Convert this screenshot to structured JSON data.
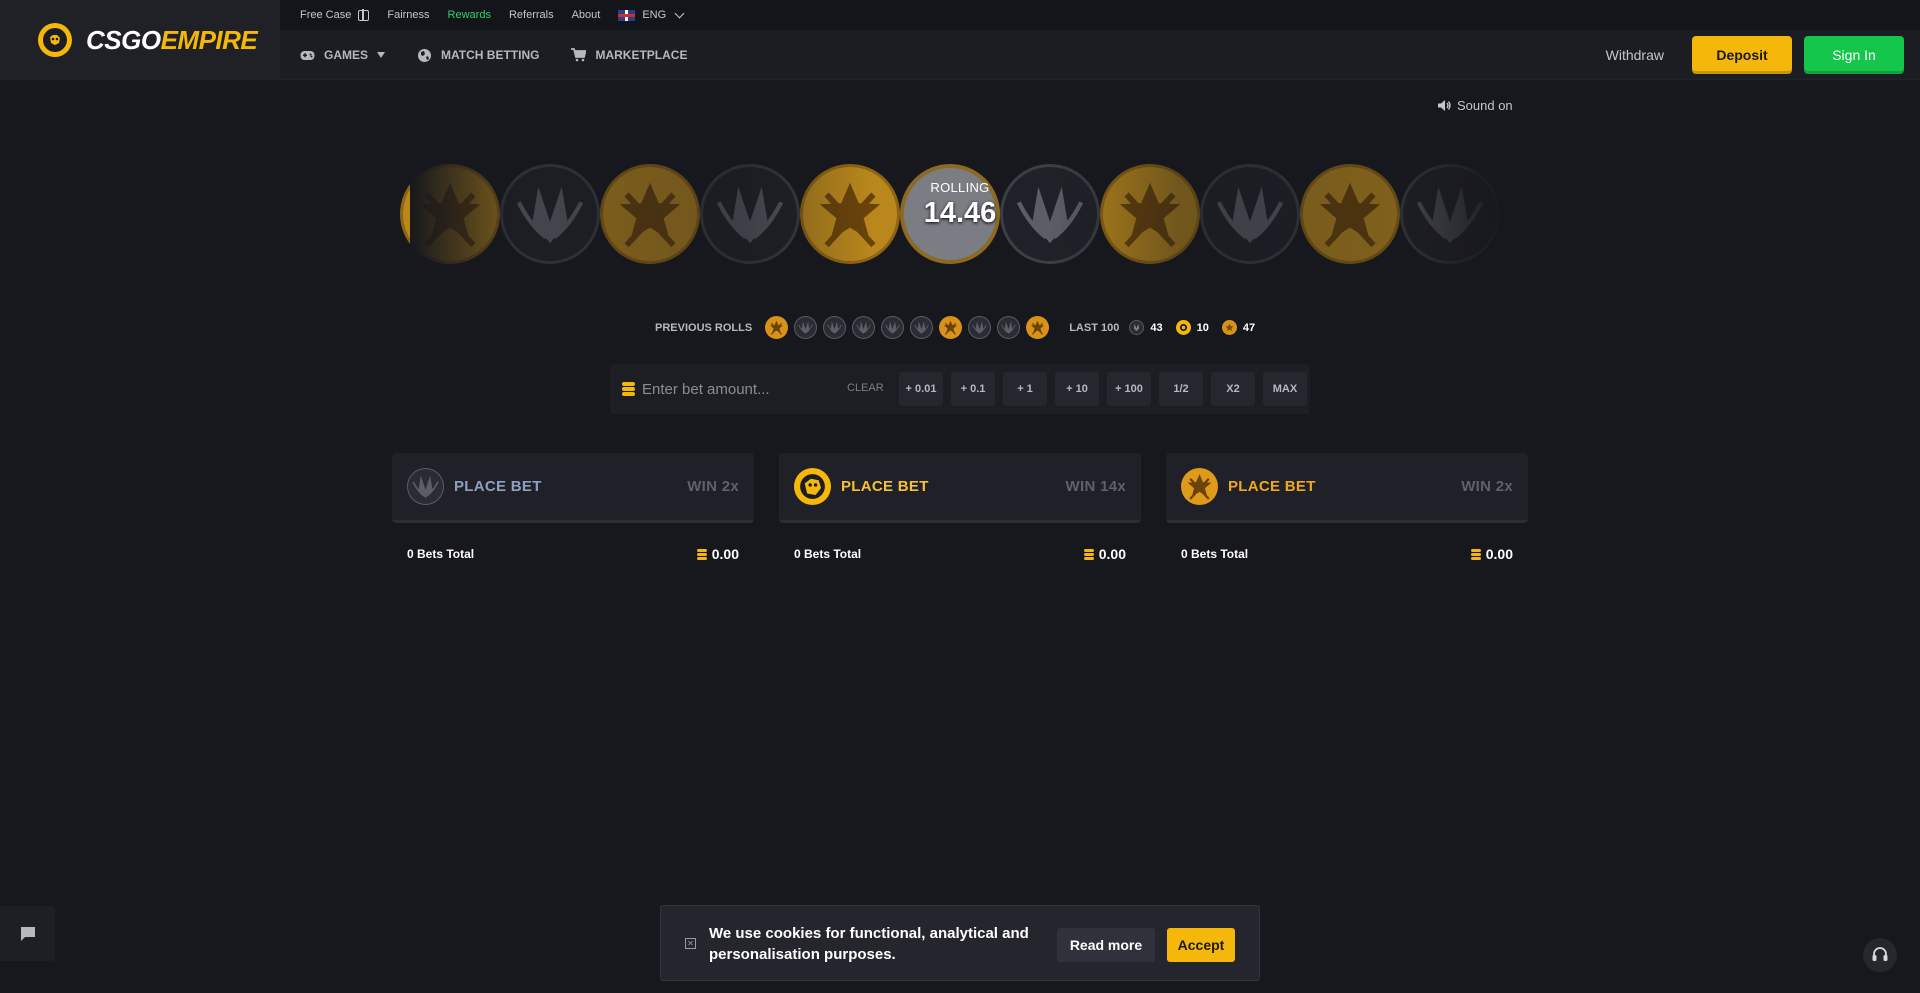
{
  "brand": {
    "name_part1": "CSGO",
    "name_part2": "EMPIRE",
    "colors": {
      "gold": "#f5b80a",
      "green": "#14c64a",
      "background": "#17181d",
      "panel": "#202128"
    }
  },
  "topbar": {
    "free_case": "Free Case",
    "fairness": "Fairness",
    "rewards": "Rewards",
    "referrals": "Referrals",
    "about": "About",
    "language": "ENG"
  },
  "nav": {
    "games": "GAMES",
    "match_betting": "MATCH BETTING",
    "marketplace": "MARKETPLACE",
    "withdraw": "Withdraw",
    "deposit": "Deposit",
    "sign_in": "Sign In"
  },
  "sound": {
    "label": "Sound on"
  },
  "roll": {
    "status": "ROLLING",
    "value": "14.46",
    "coins": [
      "t",
      "ct",
      "t",
      "ct",
      "t",
      "dice",
      "ct",
      "t",
      "ct",
      "t",
      "ct"
    ]
  },
  "previous_rolls": {
    "label": "PREVIOUS ROLLS",
    "results": [
      "t",
      "ct",
      "ct",
      "ct",
      "ct",
      "ct",
      "t",
      "ct",
      "ct",
      "t"
    ],
    "last100_label": "LAST 100",
    "counts": {
      "ct": "43",
      "dice": "10",
      "t": "47"
    }
  },
  "bet_input": {
    "placeholder": "Enter bet amount...",
    "clear": "CLEAR",
    "quick_buttons": [
      "+ 0.01",
      "+ 0.1",
      "+ 1",
      "+ 10",
      "+ 100",
      "1/2",
      "X2",
      "MAX"
    ]
  },
  "bet_columns": [
    {
      "side": "ct",
      "label": "PLACE BET",
      "win": "WIN 2x",
      "label_color": "#8ea0c0",
      "bets_total": "0 Bets Total",
      "amount": "0.00"
    },
    {
      "side": "dice",
      "label": "PLACE BET",
      "win": "WIN 14x",
      "label_color": "#f5c036",
      "bets_total": "0 Bets Total",
      "amount": "0.00"
    },
    {
      "side": "t",
      "label": "PLACE BET",
      "win": "WIN 2x",
      "label_color": "#f0a91c",
      "bets_total": "0 Bets Total",
      "amount": "0.00"
    }
  ],
  "cookie": {
    "message": "We use cookies for functional, analytical and personalisation purposes.",
    "read_more": "Read more",
    "accept": "Accept"
  }
}
